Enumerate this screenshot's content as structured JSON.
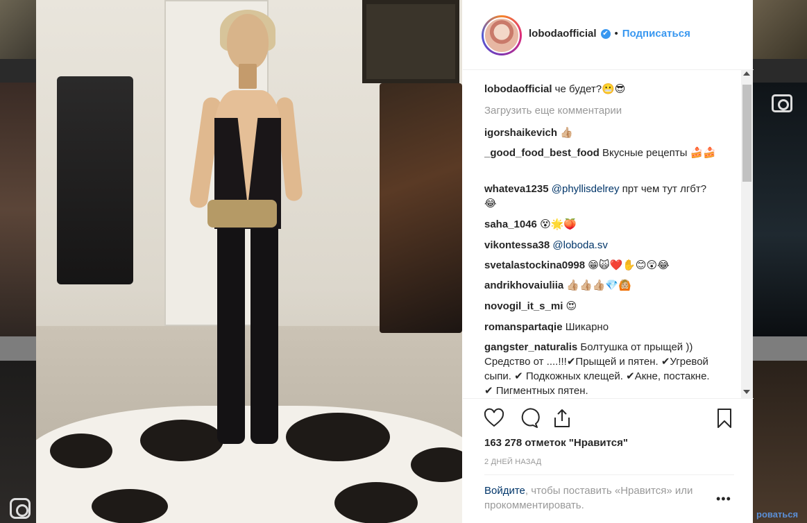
{
  "background": {
    "follow_text": "роваться"
  },
  "post": {
    "username": "lobodaofficial",
    "follow_label": "Подписаться",
    "separator": "•",
    "verified_mark": "✔",
    "likes_text": "163 278 отметок \"Нравится\"",
    "time_text": "2 дней назад",
    "login_link": "Войдите",
    "login_rest": ", чтобы поставить «Нравится» или прокомментировать.",
    "more_label": "•••",
    "load_more": "Загрузить еще комментарии"
  },
  "comments": [
    {
      "user": "lobodaofficial",
      "text": " че будет?😬😎"
    },
    {
      "user": "igorshaikevich",
      "text": " 👍🏼"
    },
    {
      "user": "_good_food_best_food",
      "text": " Вкусные рецепты 🍰🍰"
    },
    {
      "user": "whateva1235",
      "mention": " @phyllisdelrey",
      "text": " прт чем тут лгбт?😂"
    },
    {
      "user": "saha_1046",
      "text": " 😵🌟🍑"
    },
    {
      "user": "vikontessa38",
      "mention": " @loboda.sv",
      "text": ""
    },
    {
      "user": "svetalastockina0998",
      "text": " 😁🙀❤️✋😊😲😂"
    },
    {
      "user": "andrikhovaiuliia",
      "text": " 👍🏼👍🏼👍🏼💎🙆🏼"
    },
    {
      "user": "novogil_it_s_mi",
      "text": " 😍"
    },
    {
      "user": "romanspartaqie",
      "text": " Шикарно"
    },
    {
      "user": "gangster_naturalis",
      "text": " Болтушка от прыщей )) Средство от ....!!!✔Прыщей и пятен. ✔Угревой сыпи. ✔ Подкожных клещей. ✔Акне, постакне. ✔ Пигментных пятен."
    }
  ],
  "colors": {
    "link_blue": "#3897f0",
    "mention": "#003569",
    "muted": "#999999"
  },
  "icons": [
    "heart-icon",
    "comment-icon",
    "share-icon",
    "bookmark-icon",
    "verified-icon",
    "more-icon",
    "instagram-icon",
    "camera-icon"
  ]
}
